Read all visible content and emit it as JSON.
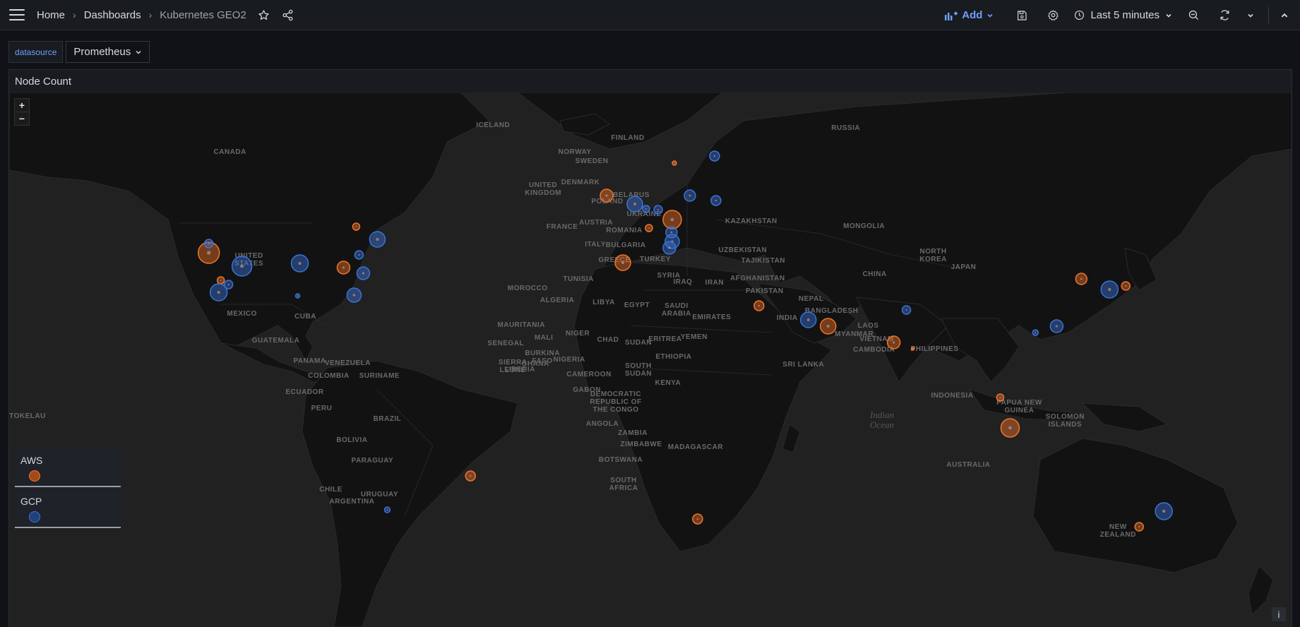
{
  "breadcrumb": {
    "home": "Home",
    "dashboards": "Dashboards",
    "current": "Kubernetes GEO2",
    "separator": "›"
  },
  "toolbar": {
    "add_label": "Add",
    "time_range": "Last 5 minutes"
  },
  "variables": {
    "label": "datasource",
    "value": "Prometheus"
  },
  "panel": {
    "title": "Node Count",
    "zoom_in": "+",
    "zoom_out": "−",
    "info": "i",
    "legend": [
      {
        "name": "AWS",
        "color": "#f2742b"
      },
      {
        "name": "GCP",
        "color": "#3b73d9"
      }
    ]
  },
  "colors": {
    "aws": "#f2742b",
    "gcp": "#3b73d9",
    "accent": "#6e9fff"
  },
  "map_labels": {
    "countries": [
      "ICELAND",
      "FINLAND",
      "SWEDEN",
      "NORWAY",
      "RUSSIA",
      "UNITED KINGDOM",
      "DENMARK",
      "POLAND",
      "BELARUS",
      "UKRAINE",
      "FRANCE",
      "AUSTRIA",
      "ROMANIA",
      "ITALY",
      "BULGARIA",
      "GREECE",
      "TURKEY",
      "KAZAKHSTAN",
      "MONGOLIA",
      "UZBEKISTAN",
      "TAJIKISTAN",
      "AFGHANISTAN",
      "PAKISTAN",
      "IRAN",
      "IRAQ",
      "SYRIA",
      "SAUDI ARABIA",
      "EMIRATES",
      "YEMEN",
      "NEPAL",
      "INDIA",
      "BANGLADESH",
      "MYANMAR",
      "LAOS",
      "VIETNAM",
      "CAMBODIA",
      "PHILIPPINES",
      "CHINA",
      "NORTH KOREA",
      "JAPAN",
      "INDONESIA",
      "PAPUA NEW GUINEA",
      "SOLOMON ISLANDS",
      "SRI LANKA",
      "AUSTRALIA",
      "NEW ZEALAND",
      "CANADA",
      "UNITED STATES",
      "MEXICO",
      "CUBA",
      "GUATEMALA",
      "PANAMA",
      "VENEZUELA",
      "COLOMBIA",
      "SURINAME",
      "ECUADOR",
      "PERU",
      "BRAZIL",
      "BOLIVIA",
      "PARAGUAY",
      "CHILE",
      "URUGUAY",
      "ARGENTINA",
      "TOKELAU",
      "MOROCCO",
      "ALGERIA",
      "TUNISIA",
      "LIBYA",
      "EGYPT",
      "MAURITANIA",
      "MALI",
      "NIGER",
      "CHAD",
      "SUDAN",
      "ERITREA",
      "ETHIOPIA",
      "SENEGAL",
      "BURKINA FASO",
      "SIERRA LEONE",
      "LIBERIA",
      "GHANA",
      "NIGERIA",
      "CAMEROON",
      "SOUTH SUDAN",
      "KENYA",
      "GABON",
      "DEMOCRATIC REPUBLIC OF THE CONGO",
      "ANGOLA",
      "ZAMBIA",
      "ZIMBABWE",
      "BOTSWANA",
      "MADAGASCAR",
      "SOUTH AFRICA"
    ],
    "oceans": [
      "Indian Ocean"
    ]
  }
}
